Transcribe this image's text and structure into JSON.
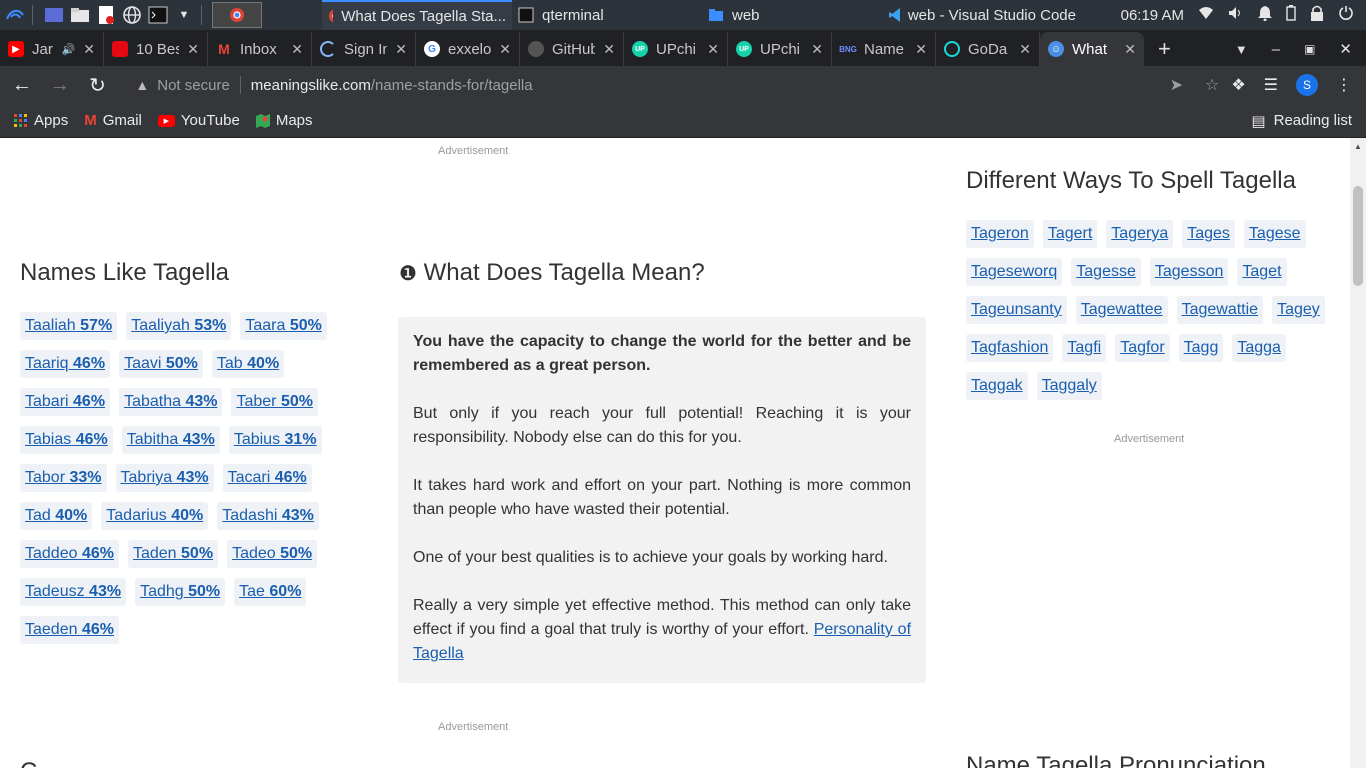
{
  "taskbar": {
    "tasks": [
      {
        "label": "What Does Tagella Sta...",
        "active": true
      },
      {
        "label": "qterminal",
        "active": false
      },
      {
        "label": "web",
        "active": false
      },
      {
        "label": "web - Visual Studio Code",
        "active": false
      }
    ],
    "clock": "06:19 AM"
  },
  "tabs": [
    {
      "label": "Jar",
      "favicon": "youtube-icon",
      "color": "#ff0000"
    },
    {
      "label": "10 Bes",
      "favicon": "red-square-icon",
      "color": "#e50914"
    },
    {
      "label": "Inbox",
      "favicon": "gmail-icon",
      "color": "#ea4335"
    },
    {
      "label": "Sign In",
      "favicon": "loading-icon",
      "color": "#8ab4f8"
    },
    {
      "label": "exxelo",
      "favicon": "google-icon",
      "color": "#4285f4"
    },
    {
      "label": "GitHub",
      "favicon": "github-icon",
      "color": "#555555"
    },
    {
      "label": "UPchi",
      "favicon": "upchieve-icon",
      "color": "#16d2aa"
    },
    {
      "label": "UPchi",
      "favicon": "upchieve-icon",
      "color": "#16d2aa"
    },
    {
      "label": "Name",
      "favicon": "bng-icon",
      "color": "#6b8cff"
    },
    {
      "label": "GoDa",
      "favicon": "godaddy-icon",
      "color": "#1bdbdb"
    },
    {
      "label": "What",
      "favicon": "meaningslike-icon",
      "color": "#4a90e2",
      "active": true
    }
  ],
  "toolbar": {
    "security_label": "Not secure",
    "url_host": "meaningslike.com",
    "url_path": "/name-stands-for/tagella",
    "profile_initial": "S"
  },
  "bookmarks": {
    "items": [
      {
        "label": "Apps",
        "icon": "apps-grid-icon"
      },
      {
        "label": "Gmail",
        "icon": "gmail-icon"
      },
      {
        "label": "YouTube",
        "icon": "youtube-icon"
      },
      {
        "label": "Maps",
        "icon": "maps-icon"
      }
    ],
    "reading_list": "Reading list"
  },
  "page": {
    "ad_label": "Advertisement",
    "names_like": {
      "title": "Names Like Tagella",
      "items": [
        {
          "name": "Taaliah",
          "pct": "57%"
        },
        {
          "name": "Taaliyah",
          "pct": "53%"
        },
        {
          "name": "Taara",
          "pct": "50%"
        },
        {
          "name": "Taariq",
          "pct": "46%"
        },
        {
          "name": "Taavi",
          "pct": "50%"
        },
        {
          "name": "Tab",
          "pct": "40%"
        },
        {
          "name": "Tabari",
          "pct": "46%"
        },
        {
          "name": "Tabatha",
          "pct": "43%"
        },
        {
          "name": "Taber",
          "pct": "50%"
        },
        {
          "name": "Tabias",
          "pct": "46%"
        },
        {
          "name": "Tabitha",
          "pct": "43%"
        },
        {
          "name": "Tabius",
          "pct": "31%"
        },
        {
          "name": "Tabor",
          "pct": "33%"
        },
        {
          "name": "Tabriya",
          "pct": "43%"
        },
        {
          "name": "Tacari",
          "pct": "46%"
        },
        {
          "name": "Tad",
          "pct": "40%"
        },
        {
          "name": "Tadarius",
          "pct": "40%"
        },
        {
          "name": "Tadashi",
          "pct": "43%"
        },
        {
          "name": "Taddeo",
          "pct": "46%"
        },
        {
          "name": "Taden",
          "pct": "50%"
        },
        {
          "name": "Tadeo",
          "pct": "50%"
        },
        {
          "name": "Tadeusz",
          "pct": "43%"
        },
        {
          "name": "Tadhg",
          "pct": "50%"
        },
        {
          "name": "Tae",
          "pct": "60%"
        },
        {
          "name": "Taeden",
          "pct": "46%"
        }
      ]
    },
    "meaning": {
      "bullet": "❶",
      "title": "What Does Tagella Mean?",
      "lead": "You have the capacity to change the world for the better and be remembered as a great person.",
      "p1": "But only if you reach your full potential! Reaching it is your responsibility. Nobody else can do this for you.",
      "p2": "It takes hard work and effort on your part. Nothing is more common than people who have wasted their potential.",
      "p3": "One of your best qualities is to achieve your goals by working hard.",
      "p4": "Really a very simple yet effective method. This method can only take effect if you find a goal that truly is worthy of your effort.",
      "link": "Personality of Tagella"
    },
    "spellings": {
      "title": "Different Ways To Spell Tagella",
      "items": [
        "Tageron",
        "Tagert",
        "Tagerya",
        "Tages",
        "Tagese",
        "Tageseworq",
        "Tagesse",
        "Tagesson",
        "Taget",
        "Tageunsanty",
        "Tagewattee",
        "Tagewattie",
        "Tagey",
        "Tagfashion",
        "Tagfi",
        "Tagfor",
        "Tagg",
        "Tagga",
        "Taggak",
        "Taggaly"
      ]
    },
    "pronunciation_title": "Name Tagella Pronunciation",
    "partial_heading": "C"
  }
}
